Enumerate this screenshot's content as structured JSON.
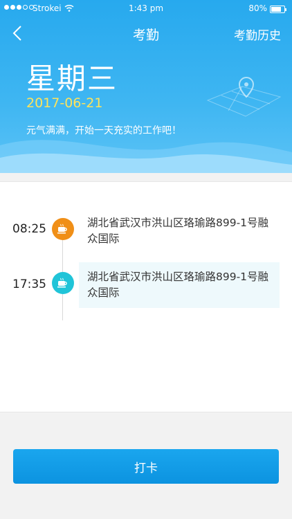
{
  "status_bar": {
    "carrier": "Strokei",
    "time": "1:43 pm",
    "battery_pct": "80%",
    "battery_level": 0.8
  },
  "nav": {
    "title": "考勤",
    "history_label": "考勤历史"
  },
  "hero": {
    "weekday": "星期三",
    "date": "2017-06-21",
    "slogan": "元气满满，开始一天充实的工作吧！"
  },
  "records": [
    {
      "time": "08:25",
      "address": "湖北省武汉市洪山区珞瑜路899-1号融众国际",
      "icon": "coffee-icon",
      "color": "#f08f17"
    },
    {
      "time": "17:35",
      "address": "湖北省武汉市洪山区珞瑜路899-1号融众国际",
      "icon": "coffee-icon",
      "color": "#20c4d8"
    }
  ],
  "punch_label": "打卡"
}
